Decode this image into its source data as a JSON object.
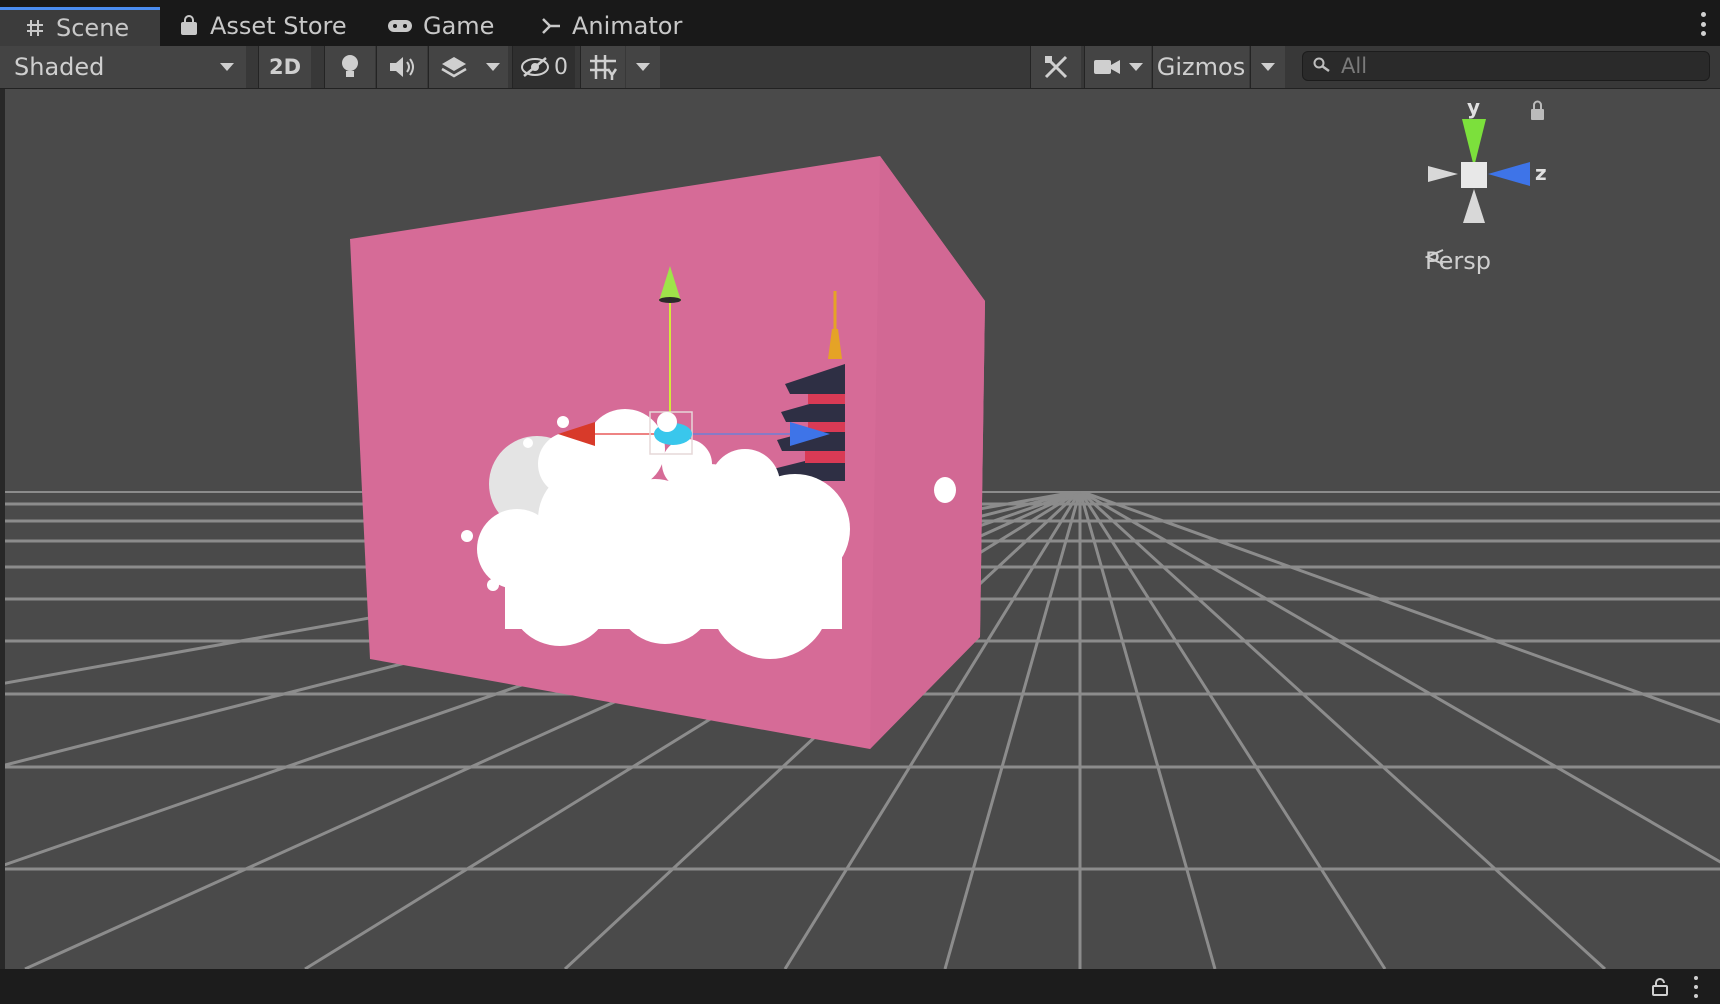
{
  "tabs": [
    {
      "label": "Scene",
      "icon": "grid-icon",
      "active": true
    },
    {
      "label": "Asset Store",
      "icon": "bag-icon",
      "active": false
    },
    {
      "label": "Game",
      "icon": "gamepad-icon",
      "active": false
    },
    {
      "label": "Animator",
      "icon": "animator-icon",
      "active": false
    }
  ],
  "toolbar": {
    "draw_mode": "Shaded",
    "mode_2d": "2D",
    "hidden_count": "0",
    "gizmos": "Gizmos",
    "search_placeholder": "All"
  },
  "scene": {
    "axis_y": "y",
    "axis_z": "z",
    "projection": "Persp",
    "colors": {
      "background": "#4a4a4a",
      "backdrop": "#d66b97",
      "grid": "#8c8c8c",
      "axis_x": "#d83a2a",
      "axis_y": "#9ee34a",
      "axis_z": "#3e74e8",
      "selection": "#39c7ec"
    }
  }
}
